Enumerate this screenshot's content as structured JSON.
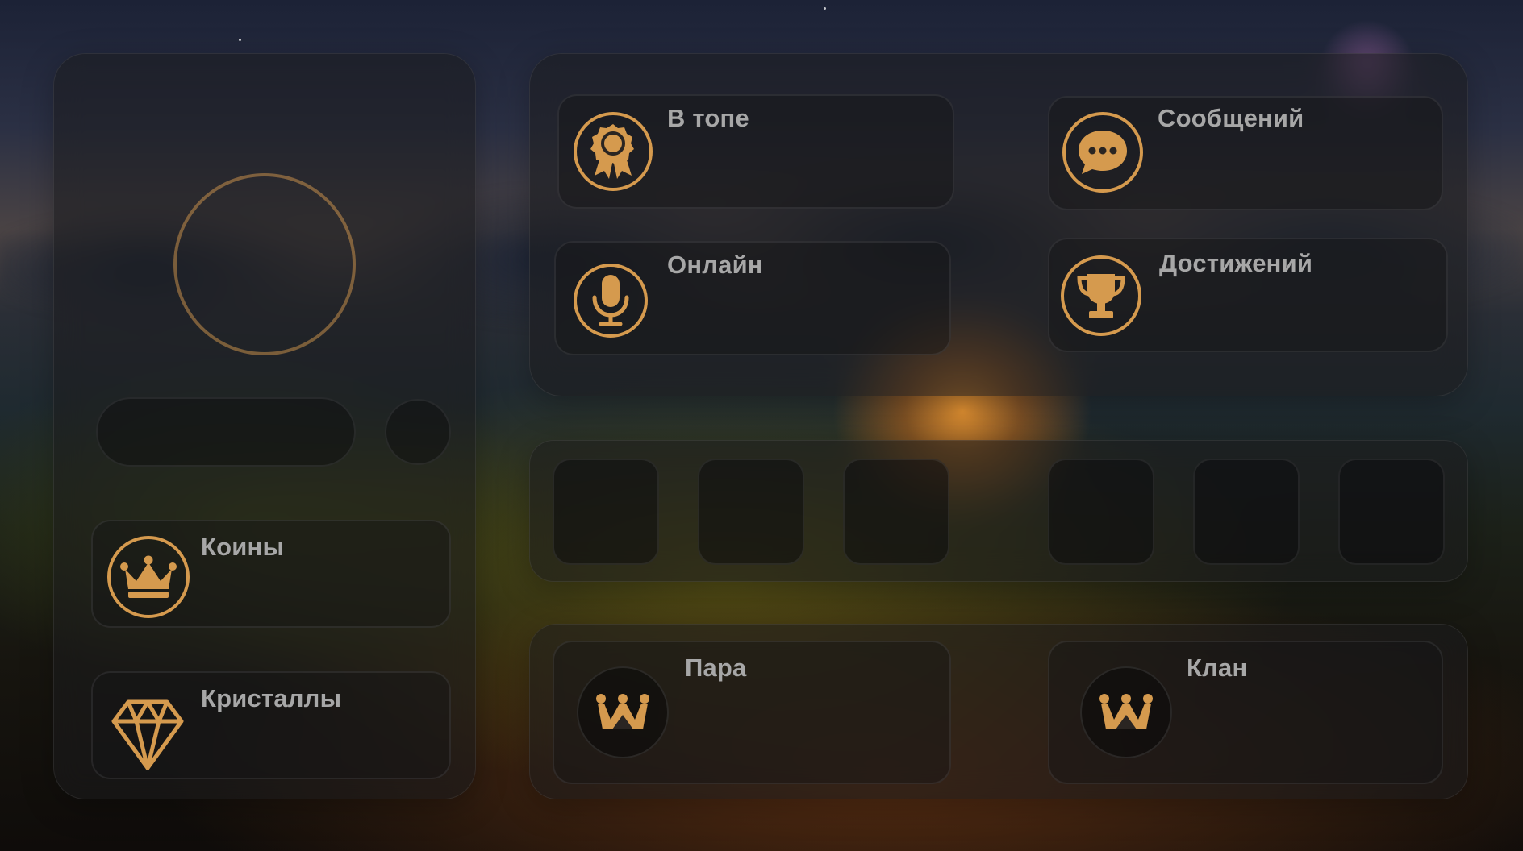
{
  "colors": {
    "accent": "#d59a4e",
    "label": "#a7a7a7"
  },
  "profile": {
    "avatar_icon": "empty-avatar-circle",
    "currencies": [
      {
        "label": "Коины",
        "icon": "crown-icon"
      },
      {
        "label": "Кристаллы",
        "icon": "diamond-icon"
      }
    ]
  },
  "stats": [
    {
      "label": "В топе",
      "icon": "award-icon"
    },
    {
      "label": "Сообщений",
      "icon": "chat-icon"
    },
    {
      "label": "Онлайн",
      "icon": "microphone-icon"
    },
    {
      "label": "Достижений",
      "icon": "trophy-icon"
    }
  ],
  "slots_count": 6,
  "relations": [
    {
      "label": "Пара",
      "icon": "couple-crown-icon"
    },
    {
      "label": "Клан",
      "icon": "clan-crown-icon"
    }
  ]
}
